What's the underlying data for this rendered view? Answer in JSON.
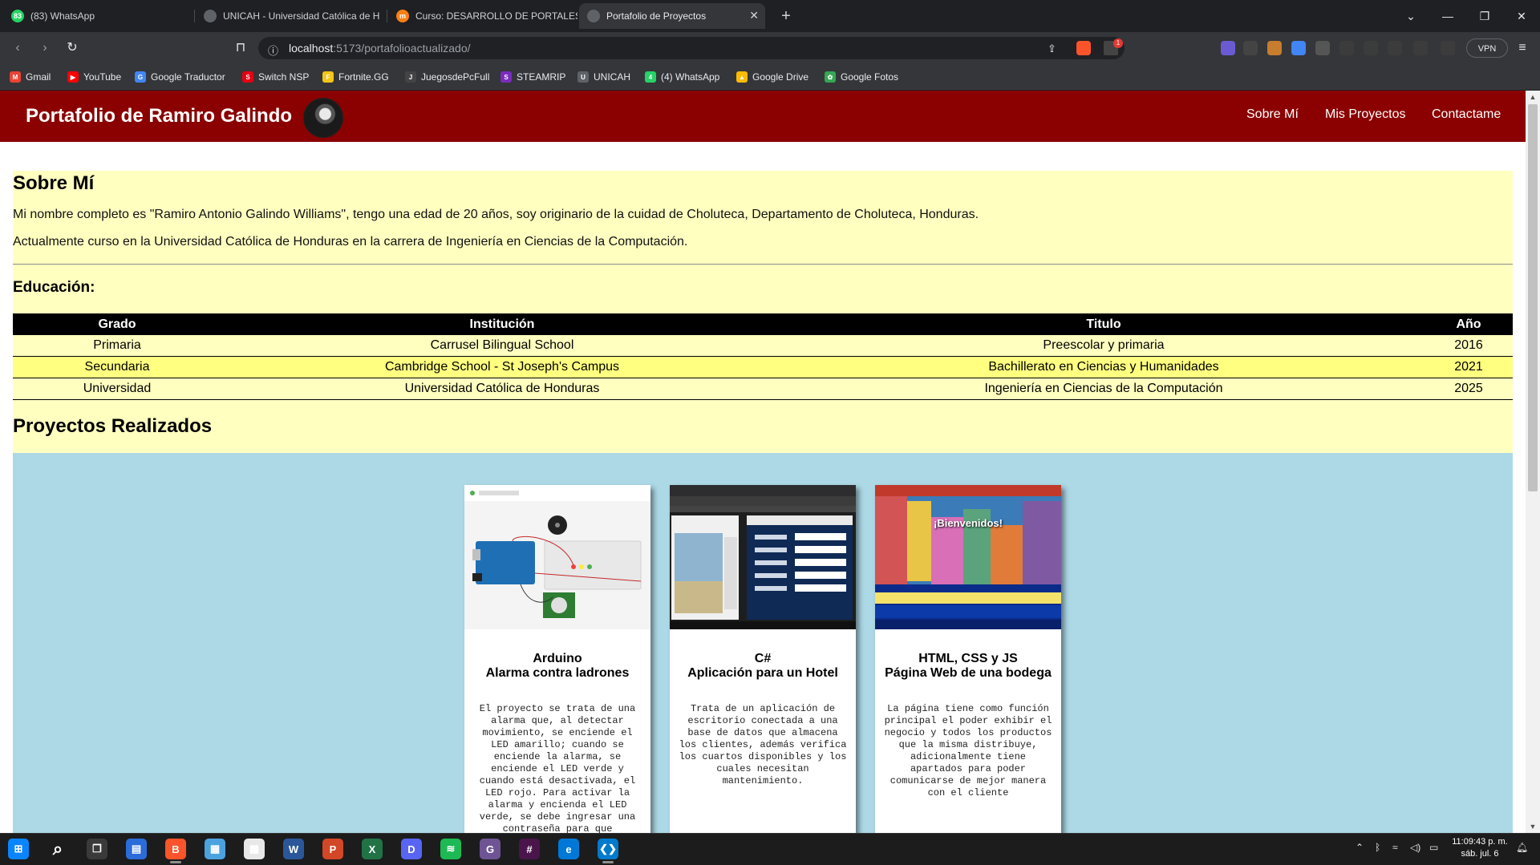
{
  "browser": {
    "tabs": [
      {
        "title": "(83) WhatsApp",
        "icon": "whatsapp-icon",
        "color": "#25d366",
        "glyph": "83"
      },
      {
        "title": "UNICAH - Universidad Católica de H",
        "icon": "globe-icon",
        "color": "#5f6368",
        "glyph": ""
      },
      {
        "title": "Curso: DESARROLLO DE PORTALES W",
        "icon": "moodle-icon",
        "color": "#f98012",
        "glyph": "m"
      },
      {
        "title": "Portafolio de Proyectos",
        "icon": "globe-icon",
        "color": "#5f6368",
        "glyph": ""
      }
    ],
    "new_tab": "+",
    "url_host": "localhost",
    "url_rest": ":5173/portafolioactualizado/",
    "vpn_label": "VPN",
    "shield_badge": "1",
    "bookmarks": [
      {
        "label": "Gmail",
        "icon": "gmail-icon",
        "color": "#ea4335",
        "glyph": "M"
      },
      {
        "label": "YouTube",
        "icon": "youtube-icon",
        "color": "#ff0000",
        "glyph": "▶"
      },
      {
        "label": "Google Traductor",
        "icon": "translate-icon",
        "color": "#4285f4",
        "glyph": "G"
      },
      {
        "label": "Switch NSP",
        "icon": "switch-icon",
        "color": "#e60012",
        "glyph": "S"
      },
      {
        "label": "Fortnite.GG",
        "icon": "fortnite-icon",
        "color": "#f5c518",
        "glyph": "F"
      },
      {
        "label": "JuegosdePcFull",
        "icon": "game-icon",
        "color": "#444444",
        "glyph": "J"
      },
      {
        "label": "STEAMRIP",
        "icon": "steamrip-icon",
        "color": "#7b2cbf",
        "glyph": "S"
      },
      {
        "label": "UNICAH",
        "icon": "globe-icon",
        "color": "#5f6368",
        "glyph": "U"
      },
      {
        "label": "(4) WhatsApp",
        "icon": "whatsapp-icon",
        "color": "#25d366",
        "glyph": "4"
      },
      {
        "label": "Google Drive",
        "icon": "drive-icon",
        "color": "#fbbc04",
        "glyph": "▲"
      },
      {
        "label": "Google Fotos",
        "icon": "photos-icon",
        "color": "#34a853",
        "glyph": "✿"
      }
    ]
  },
  "site": {
    "header_title": "Portafolio de Ramiro Galindo",
    "nav": [
      "Sobre Mí",
      "Mis Proyectos",
      "Contactame"
    ],
    "about": {
      "heading": "Sobre Mí",
      "p1": "Mi nombre completo es \"Ramiro Antonio Galindo Williams\", tengo una edad de 20 años, soy originario de la cuidad de Choluteca, Departamento de Choluteca, Honduras.",
      "p2": "Actualmente curso en la Universidad Católica de Honduras en la carrera de Ingeniería en Ciencias de la Computación.",
      "education_heading": "Educación:",
      "table": {
        "headers": [
          "Grado",
          "Institución",
          "Titulo",
          "Año"
        ],
        "rows": [
          [
            "Primaria",
            "Carrusel Bilingual School",
            "Preescolar y primaria",
            "2016"
          ],
          [
            "Secundaria",
            "Cambridge School - St Joseph's Campus",
            "Bachillerato en Ciencias y Humanidades",
            "2021"
          ],
          [
            "Universidad",
            "Universidad Católica de Honduras",
            "Ingeniería en Ciencias de la Computación",
            "2025"
          ]
        ]
      }
    },
    "projects": {
      "heading": "Proyectos Realizados",
      "cards": [
        {
          "title1": "Arduino",
          "title2": "Alarma contra ladrones",
          "desc": "El proyecto se trata de una alarma que, al detectar movimiento, se enciende el LED amarillo; cuando se enciende la alarma, se enciende el LED verde y cuando está desactivada, el LED rojo. Para activar la alarma y encienda el LED verde, se debe ingresar una contraseña para que"
        },
        {
          "title1": "C#",
          "title2": "Aplicación para un Hotel",
          "desc": "Trata de un aplicación de escritorio conectada a una base de datos que almacena los clientes, además verifica los cuartos disponibles y los cuales necesitan mantenimiento."
        },
        {
          "title1": "HTML, CSS y JS",
          "title2": "Página Web de una bodega",
          "desc": "La página tiene como función principal el poder exhibir el negocio y todos los productos que la misma distribuye, adicionalmente tiene apartados para poder comunicarse de mejor manera con el cliente",
          "banner": "¡Bienvenidos!"
        }
      ]
    }
  },
  "taskbar": {
    "apps": [
      {
        "name": "start-icon",
        "color": "#0a84ff",
        "glyph": "⊞"
      },
      {
        "name": "search-icon",
        "color": "#1c1c1c",
        "glyph": "⌕"
      },
      {
        "name": "task-view-icon",
        "color": "#3a3a3a",
        "glyph": "❐"
      },
      {
        "name": "file-explorer-icon",
        "color": "#2b6cd8",
        "glyph": "▤"
      },
      {
        "name": "brave-icon",
        "color": "#fb542b",
        "glyph": "B"
      },
      {
        "name": "control-panel-icon",
        "color": "#4aa3df",
        "glyph": "▦"
      },
      {
        "name": "store-icon",
        "color": "#e8e8e8",
        "glyph": "▩"
      },
      {
        "name": "word-icon",
        "color": "#2b579a",
        "glyph": "W"
      },
      {
        "name": "powerpoint-icon",
        "color": "#d24726",
        "glyph": "P"
      },
      {
        "name": "excel-icon",
        "color": "#217346",
        "glyph": "X"
      },
      {
        "name": "discord-icon",
        "color": "#5865f2",
        "glyph": "D"
      },
      {
        "name": "spotify-icon",
        "color": "#1db954",
        "glyph": "≋"
      },
      {
        "name": "github-icon",
        "color": "#6e5494",
        "glyph": "G"
      },
      {
        "name": "slack-icon",
        "color": "#4a154b",
        "glyph": "#"
      },
      {
        "name": "edge-icon",
        "color": "#0078d7",
        "glyph": "e"
      },
      {
        "name": "vscode-icon",
        "color": "#007acc",
        "glyph": "❮❯"
      }
    ],
    "time": "11:09:43 p. m.",
    "date": "sáb. jul. 6"
  }
}
